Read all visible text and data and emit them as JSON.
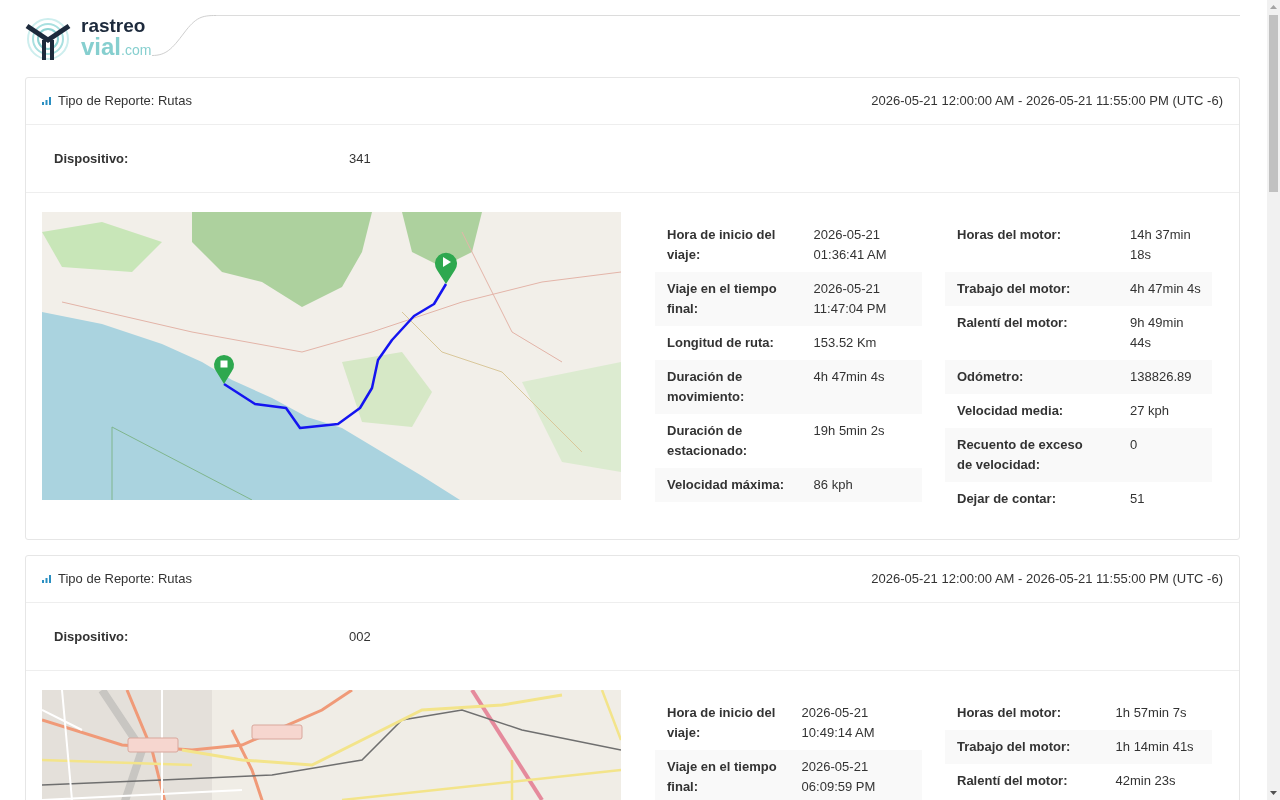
{
  "logo": {
    "line_1": "rastreo",
    "line_2": "vial",
    "line_2_suffix": ".com"
  },
  "reports": [
    {
      "title": "Tipo de Reporte: Rutas",
      "period": "2026-05-21 12:00:00 AM - 2026-05-21 11:55:00 PM (UTC -6)",
      "device_label": "Dispositivo:",
      "device": "341",
      "map": {
        "kind": "coast"
      },
      "trip_stats": [
        {
          "label": "Hora de inicio del viaje:",
          "value": "2026-05-21 01:36:41 AM"
        },
        {
          "label": "Viaje en el tiempo final:",
          "value": "2026-05-21 11:47:04 PM"
        },
        {
          "label": "Longitud de ruta:",
          "value": "153.52 Km"
        },
        {
          "label": "Duración de movimiento:",
          "value": "4h 47min 4s"
        },
        {
          "label": "Duración de estacionado:",
          "value": "19h 5min 2s"
        },
        {
          "label": "Velocidad máxima:",
          "value": "86 kph"
        }
      ],
      "engine_stats": [
        {
          "label": "Horas del motor:",
          "value": "14h 37min 18s"
        },
        {
          "label": "Trabajo del motor:",
          "value": "4h 47min 4s"
        },
        {
          "label": "Ralentí del motor:",
          "value": "9h 49min 44s"
        },
        {
          "label": "Odómetro:",
          "value": "138826.89"
        },
        {
          "label": "Velocidad media:",
          "value": "27 kph"
        },
        {
          "label": "Recuento de exceso de velocidad:",
          "value": "0"
        },
        {
          "label": "Dejar de contar:",
          "value": "51"
        }
      ]
    },
    {
      "title": "Tipo de Reporte: Rutas",
      "period": "2026-05-21 12:00:00 AM - 2026-05-21 11:55:00 PM (UTC -6)",
      "device_label": "Dispositivo:",
      "device": "002",
      "map": {
        "kind": "city"
      },
      "trip_stats": [
        {
          "label": "Hora de inicio del viaje:",
          "value": "2026-05-21 10:49:14 AM"
        },
        {
          "label": "Viaje en el tiempo final:",
          "value": "2026-05-21 06:09:59 PM"
        }
      ],
      "engine_stats": [
        {
          "label": "Horas del motor:",
          "value": "1h 57min 7s"
        },
        {
          "label": "Trabajo del motor:",
          "value": "1h 14min 41s"
        },
        {
          "label": "Ralentí del motor:",
          "value": "42min 23s"
        }
      ]
    }
  ]
}
